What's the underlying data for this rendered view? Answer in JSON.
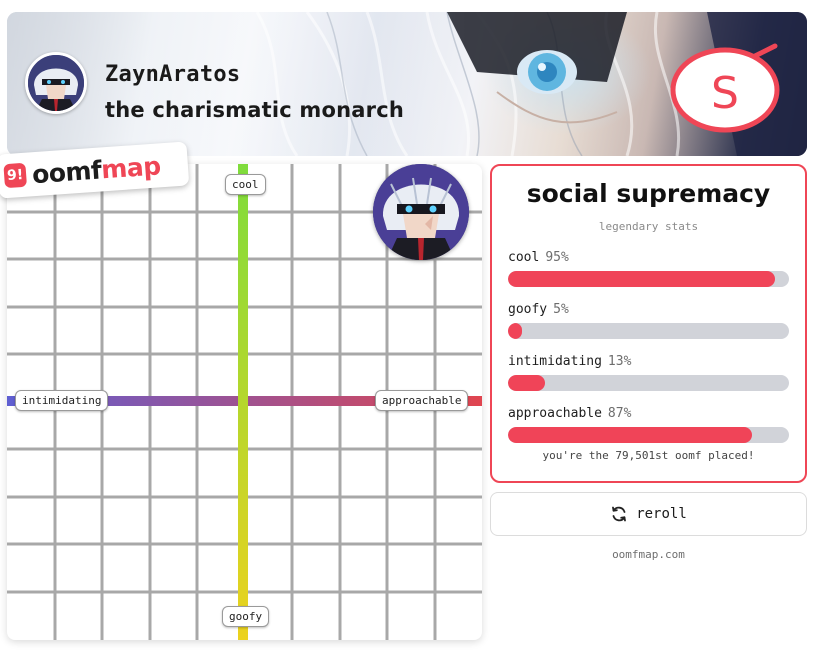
{
  "banner": {
    "username": "ZaynAratos",
    "title": "the charismatic monarch",
    "badge_letter": "S"
  },
  "logo": {
    "pin_glyph": "9!",
    "part_a": "oomf",
    "part_b": "map"
  },
  "map": {
    "axes": {
      "top": "cool",
      "bottom": "goofy",
      "left": "intimidating",
      "right": "approachable"
    },
    "colors": {
      "vertical_top": "#7fdc3c",
      "vertical_bottom": "#ecd21e",
      "horizontal_left": "#5f5fd2",
      "horizontal_right": "#e0454f"
    }
  },
  "stats": {
    "title": "social supremacy",
    "subtitle": "legendary stats",
    "items": [
      {
        "label": "cool",
        "pct_text": "95%",
        "value": 95
      },
      {
        "label": "goofy",
        "pct_text": "5%",
        "value": 5
      },
      {
        "label": "intimidating",
        "pct_text": "13%",
        "value": 13
      },
      {
        "label": "approachable",
        "pct_text": "87%",
        "value": 87
      }
    ],
    "footer": "you're the 79,501st oomf placed!",
    "accent": "#f04458"
  },
  "reroll": {
    "label": "reroll",
    "icon": "refresh-icon"
  },
  "site": "oomfmap.com"
}
